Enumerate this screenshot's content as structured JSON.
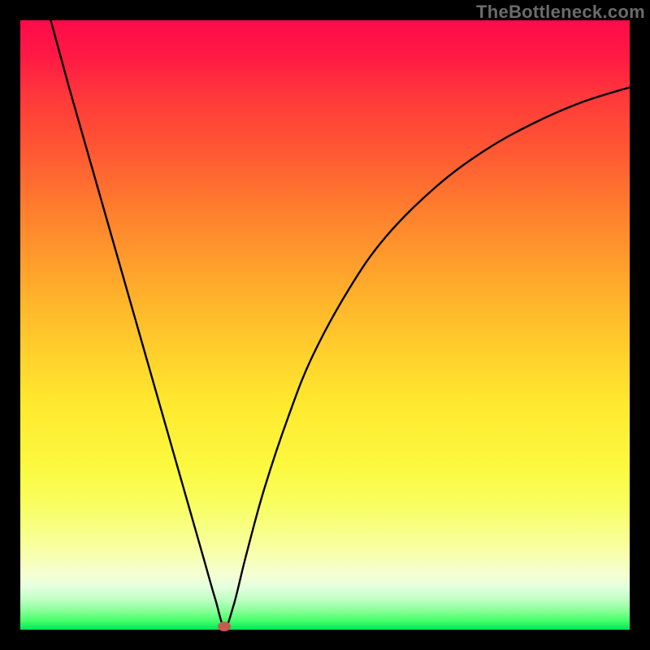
{
  "watermark": "TheBottleneck.com",
  "chart_data": {
    "type": "line",
    "title": "",
    "xlabel": "",
    "ylabel": "",
    "xlim": [
      0,
      100
    ],
    "ylim": [
      0,
      100
    ],
    "grid": false,
    "background_gradient": {
      "top": "#ff0a4a",
      "bottom": "#00e756",
      "meaning_top": "high bottleneck",
      "meaning_bottom": "no bottleneck"
    },
    "series": [
      {
        "name": "bottleneck-curve",
        "color": "#000000",
        "x": [
          5,
          8,
          12,
          16,
          20,
          24,
          28,
          30,
          32,
          33.5,
          35,
          37,
          40,
          44,
          48,
          54,
          60,
          68,
          76,
          84,
          92,
          100
        ],
        "y": [
          100,
          89,
          75,
          61,
          47,
          33,
          19,
          12,
          5,
          0.5,
          4,
          12,
          23,
          35,
          45,
          56,
          64.5,
          72.5,
          78.5,
          83,
          86.5,
          89
        ]
      }
    ],
    "marker": {
      "name": "optimal-point",
      "x": 33.5,
      "y": 0.5,
      "color": "#c95a52"
    }
  }
}
